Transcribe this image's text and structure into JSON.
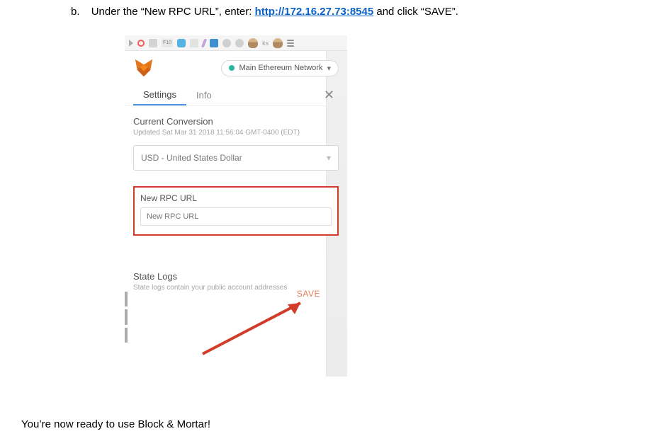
{
  "doc": {
    "bullet": "b.",
    "instr_pre": "Under the “New RPC URL”, enter: ",
    "link_text": "http://172.16.27.73:8545",
    "instr_post": " and click “SAVE”.",
    "final": "You’re now ready to use Block & Mortar!"
  },
  "toolbar": {
    "f10": "F10",
    "ks": "ks"
  },
  "popup": {
    "network_label": "Main Ethereum Network",
    "tabs": {
      "settings": "Settings",
      "info": "Info"
    },
    "close": "✕",
    "conversion": {
      "title": "Current Conversion",
      "updated": "Updated Sat Mar 31 2018 11:56:04 GMT-0400 (EDT)",
      "selected": "USD - United States Dollar"
    },
    "rpc": {
      "label": "New RPC URL",
      "placeholder": "New RPC URL",
      "save": "SAVE"
    },
    "state": {
      "title": "State Logs",
      "desc": "State logs contain your public account addresses"
    }
  }
}
